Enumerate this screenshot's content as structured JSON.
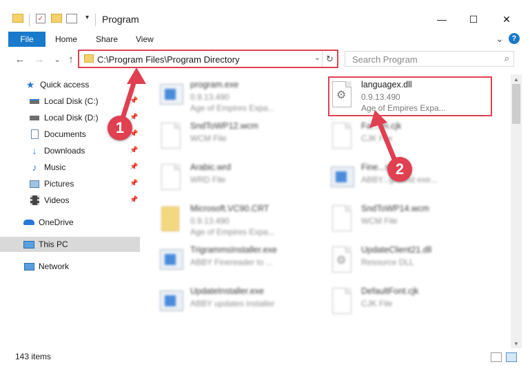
{
  "window": {
    "title": "Program",
    "minimize_glyph": "—",
    "maximize_glyph": "☐",
    "close_glyph": "✕"
  },
  "ribbon": {
    "tabs": [
      "File",
      "Home",
      "Share",
      "View"
    ],
    "expand_glyph": "⌄",
    "help_glyph": "?"
  },
  "nav": {
    "back_glyph": "←",
    "forward_glyph": "→",
    "recent_glyph": "⌄",
    "up_glyph": "↑",
    "address": "C:\\Program Files\\Program Directory",
    "search_placeholder": "Search Program"
  },
  "sidebar": {
    "items": [
      {
        "label": "Quick access",
        "icon": "star-icon"
      },
      {
        "label": "Local Disk (C:)",
        "icon": "drive-icon",
        "pinned": true
      },
      {
        "label": "Local Disk (D:)",
        "icon": "drive-icon",
        "pinned": true
      },
      {
        "label": "Documents",
        "icon": "documents-icon",
        "pinned": true
      },
      {
        "label": "Downloads",
        "icon": "downloads-icon",
        "pinned": true
      },
      {
        "label": "Music",
        "icon": "music-icon",
        "pinned": true
      },
      {
        "label": "Pictures",
        "icon": "pictures-icon",
        "pinned": true
      },
      {
        "label": "Videos",
        "icon": "videos-icon",
        "pinned": true
      },
      {
        "label": "OneDrive",
        "icon": "cloud-icon"
      },
      {
        "label": "This PC",
        "icon": "pc-icon",
        "selected": true
      },
      {
        "label": "Network",
        "icon": "network-icon"
      }
    ]
  },
  "files": [
    {
      "name": "program.exe",
      "line2": "0.9.13.490",
      "line3": "Age of Empires Expa...",
      "icon": "exe-icon",
      "blurred": true
    },
    {
      "name": "languagex.dll",
      "line2": "0.9.13.490",
      "line3": "Age of Empires Expa...",
      "icon": "dll-gear-icon",
      "blurred": false,
      "highlighted": true
    },
    {
      "name": "SndToWP12.wcm",
      "line2": "WCM File",
      "line3": "",
      "icon": "doc-icon",
      "blurred": true
    },
    {
      "name": "Fa...rm.cjk",
      "line2": "CJK File",
      "line3": "",
      "icon": "doc-icon",
      "blurred": true
    },
    {
      "name": "Arabic.wrd",
      "line2": "WRD File",
      "line3": "",
      "icon": "doc-icon",
      "blurred": true
    },
    {
      "name": "Fine...se",
      "line2": "ABBY...ground exe...",
      "line3": "",
      "icon": "app-icon",
      "blurred": true
    },
    {
      "name": "Microsoft.VC90.CRT",
      "line2": "0.9.13.490",
      "line3": "Age of Empires Expa...",
      "icon": "folder-doc-icon",
      "blurred": true
    },
    {
      "name": "SndToWP14.wcm",
      "line2": "WCM File",
      "line3": "",
      "icon": "doc-icon",
      "blurred": true
    },
    {
      "name": "TrigrammsInstaller.exe",
      "line2": "ABBY Finereader to ...",
      "line3": "",
      "icon": "app-icon",
      "blurred": true
    },
    {
      "name": "UpdateClient21.dll",
      "line2": "Resource DLL",
      "line3": "",
      "icon": "dll-gear-icon",
      "blurred": true
    },
    {
      "name": "UpdateInstaller.exe",
      "line2": "ABBY updates installer",
      "line3": "",
      "icon": "app-icon",
      "blurred": true
    },
    {
      "name": "DefaultFont.cjk",
      "line2": "CJK File",
      "line3": "",
      "icon": "doc-icon",
      "blurred": true
    }
  ],
  "status": {
    "item_count": "143 items"
  },
  "annotations": {
    "callout1": "1",
    "callout2": "2",
    "color": "#e04050"
  }
}
